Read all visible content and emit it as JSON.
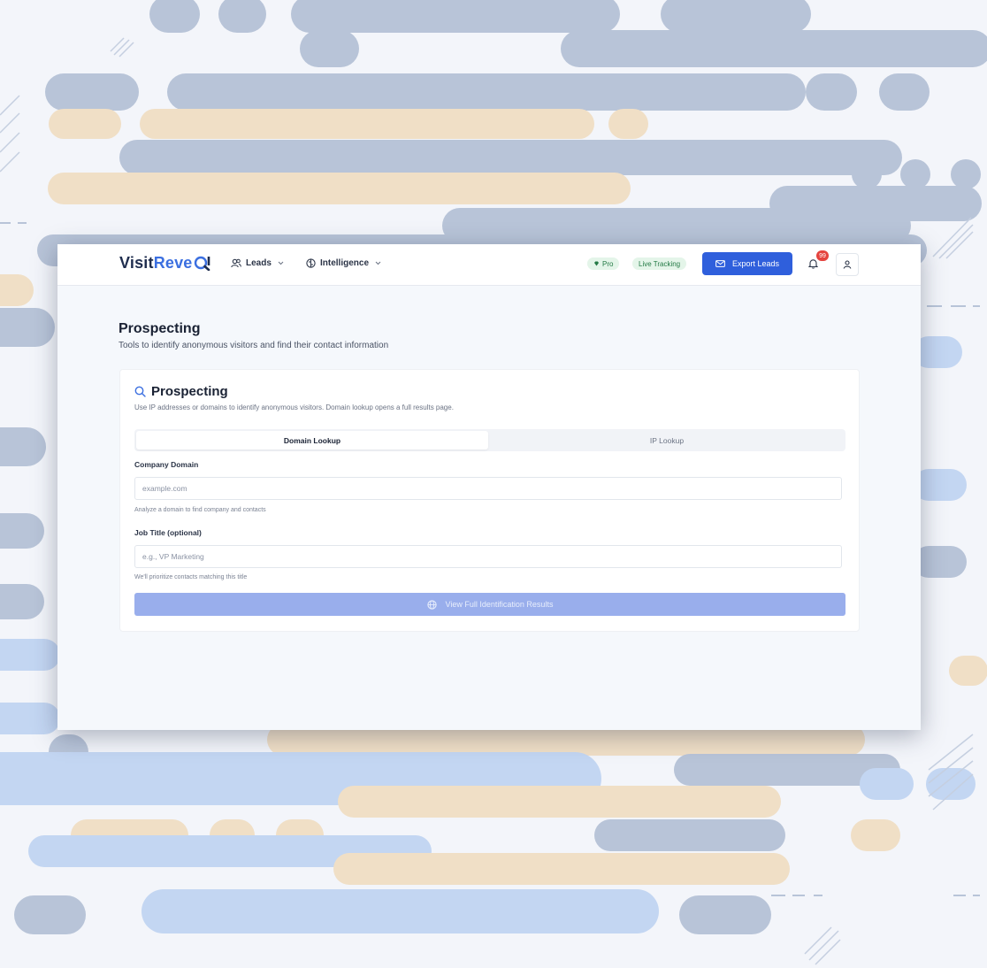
{
  "brand": {
    "name_part1": "Visit",
    "name_part2": "Reve",
    "accent_color": "#3b6fe0"
  },
  "nav": {
    "leads_label": "Leads",
    "intelligence_label": "Intelligence"
  },
  "header": {
    "pro_badge": "Pro",
    "live_badge": "Live Tracking",
    "export_label": "Export Leads",
    "notification_count": "99"
  },
  "page": {
    "title": "Prospecting",
    "subtitle": "Tools to identify anonymous visitors and find their contact information"
  },
  "card": {
    "title": "Prospecting",
    "description": "Use IP addresses or domains to identify anonymous visitors. Domain lookup opens a full results page.",
    "tabs": [
      {
        "label": "Domain Lookup",
        "active": true
      },
      {
        "label": "IP Lookup",
        "active": false
      }
    ],
    "company_domain_label": "Company Domain",
    "company_domain_placeholder": "example.com",
    "company_domain_hint": "Analyze a domain to find company and contacts",
    "job_title_label": "Job Title (optional)",
    "job_title_placeholder": "e.g., VP Marketing",
    "job_title_hint": "We'll prioritize contacts matching this title",
    "submit_label": "View Full Identification Results"
  },
  "colors": {
    "primary_button": "#2f5fdc",
    "disabled_button": "#99aeec",
    "badge_bg": "#e4f5e9",
    "notification_badge": "#e5443f"
  }
}
